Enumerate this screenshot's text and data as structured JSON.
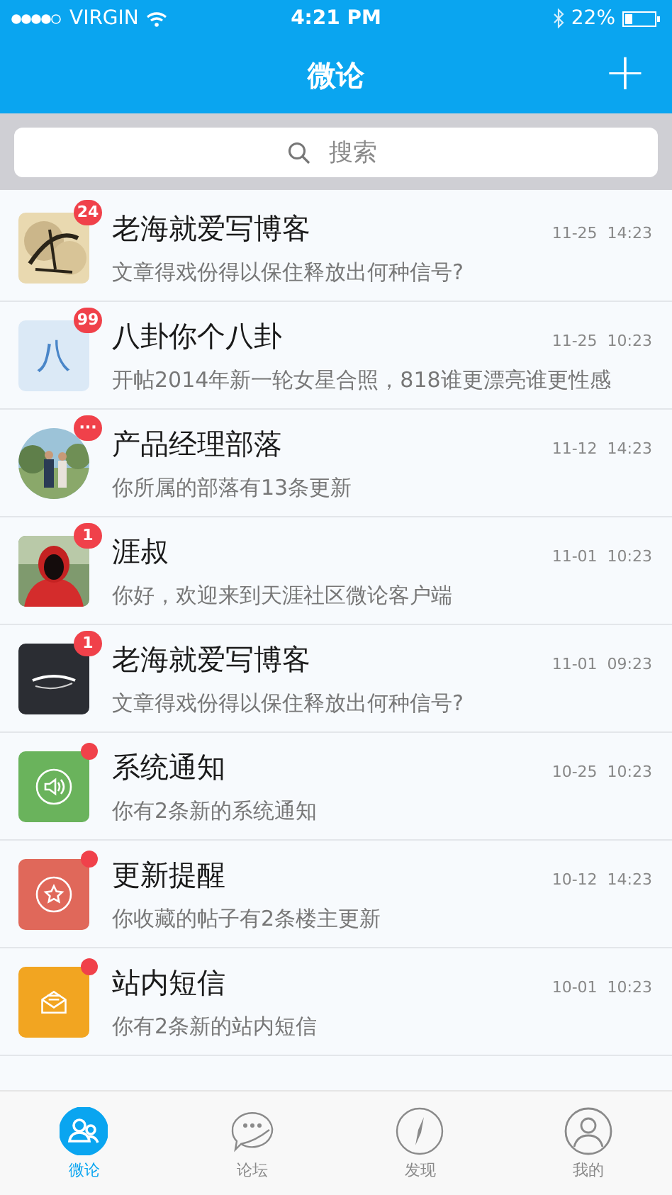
{
  "status_bar": {
    "carrier": "VIRGIN",
    "time": "4:21 PM",
    "battery": "22%"
  },
  "nav_bar": {
    "title": "微论",
    "action": "+"
  },
  "search": {
    "placeholder": "搜索"
  },
  "conversations": [
    {
      "badge": {
        "kind": "count",
        "text": "24"
      },
      "name": "老海就爱写博客",
      "time": "11-25  14:23",
      "preview": "文章得戏份得以保住释放出何种信号?"
    },
    {
      "avatar": {
        "kind": "letter",
        "text": "八"
      },
      "badge": {
        "kind": "count",
        "text": "99"
      },
      "name": "八卦你个八卦",
      "time": "11-25  10:23",
      "preview": "开帖2014年新一轮女星合照，818谁更漂亮谁更性感"
    },
    {
      "avatar": {
        "kind": "round-picture"
      },
      "badge": {
        "kind": "count",
        "text": "···"
      },
      "name": "产品经理部落",
      "time": "11-12  14:23",
      "preview": "你所属的部落有13条更新"
    },
    {
      "badge": {
        "kind": "count",
        "text": "1"
      },
      "name": "涯叔",
      "time": "11-01  10:23",
      "preview": "你好，欢迎来到天涯社区微论客户端"
    },
    {
      "badge": {
        "kind": "count",
        "text": "1"
      },
      "name": "老海就爱写博客",
      "time": "11-01  09:23",
      "preview": "文章得戏份得以保住释放出何种信号?"
    },
    {
      "avatar": {
        "kind": "speaker",
        "color": "#6ab35c"
      },
      "badge": {
        "kind": "dot"
      },
      "name": "系统通知",
      "time": "10-25  10:23",
      "preview": "你有2条新的系统通知"
    },
    {
      "avatar": {
        "kind": "star",
        "color": "#e0685a"
      },
      "badge": {
        "kind": "dot"
      },
      "name": "更新提醒",
      "time": "10-12  14:23",
      "preview": "你收藏的帖子有2条楼主更新"
    },
    {
      "avatar": {
        "kind": "envelope",
        "color": "#f2a521"
      },
      "badge": {
        "kind": "dot"
      },
      "name": "站内短信",
      "time": "10-01  10:23",
      "preview": "你有2条新的站内短信"
    }
  ],
  "tab_bar": [
    {
      "label": "微论",
      "kind": "people",
      "selected": true
    },
    {
      "label": "论坛",
      "kind": "chat",
      "selected": false
    },
    {
      "label": "发现",
      "kind": "compass",
      "selected": false
    },
    {
      "label": "我的",
      "kind": "person",
      "selected": false
    }
  ]
}
